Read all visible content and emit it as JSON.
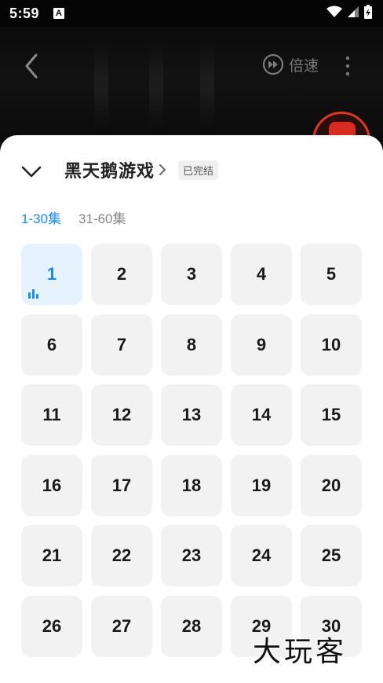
{
  "status_bar": {
    "time": "5:59",
    "notification_letter": "A",
    "icons": [
      "wifi-icon",
      "signal-icon",
      "battery-charging-icon"
    ]
  },
  "player": {
    "speed_label": "倍速",
    "icons": [
      "back-icon",
      "speed-icon",
      "more-icon"
    ]
  },
  "sheet": {
    "title": "黑天鹅游戏",
    "status_badge": "已完结",
    "tabs": [
      {
        "label": "1-30集",
        "active": true
      },
      {
        "label": "31-60集",
        "active": false
      }
    ],
    "current_episode": "1",
    "episodes": [
      "1",
      "2",
      "3",
      "4",
      "5",
      "6",
      "7",
      "8",
      "9",
      "10",
      "11",
      "12",
      "13",
      "14",
      "15",
      "16",
      "17",
      "18",
      "19",
      "20",
      "21",
      "22",
      "23",
      "24",
      "25",
      "26",
      "27",
      "28",
      "29",
      "30"
    ]
  },
  "watermark": "大玩客",
  "colors": {
    "accent": "#1a8cf0",
    "tile_bg": "#f2f2f2",
    "tile_active_bg": "#e6f2fe"
  }
}
